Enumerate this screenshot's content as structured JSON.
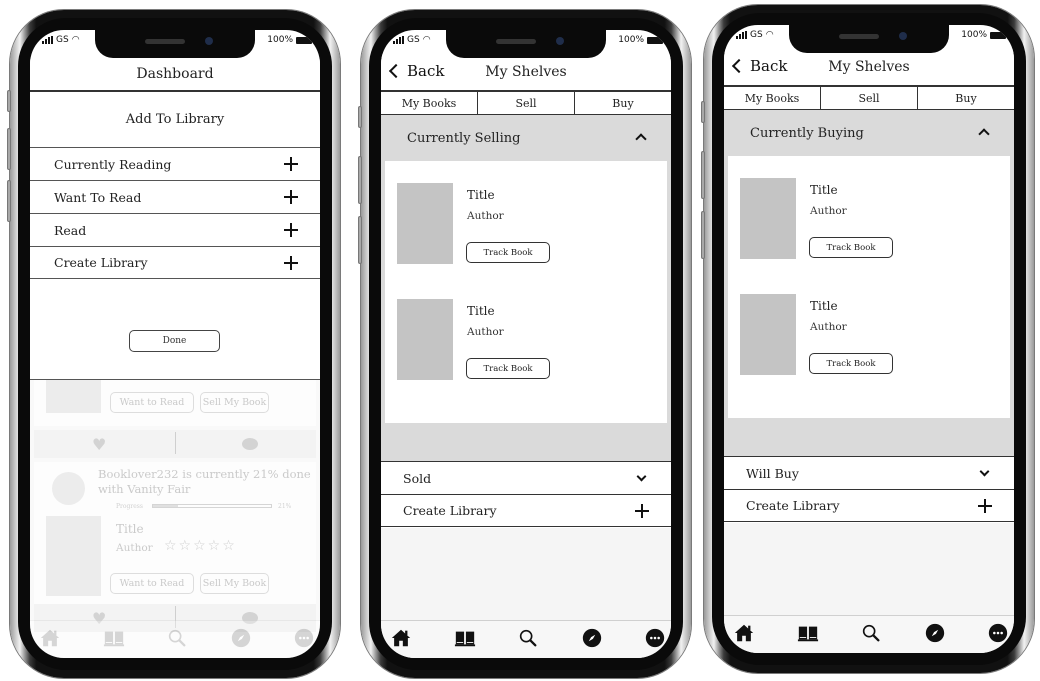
{
  "status_bar": {
    "carrier": "GS",
    "battery": "100%"
  },
  "phone1": {
    "header_title": "Dashboard",
    "modal": {
      "title": "Add To Library",
      "items": [
        {
          "label": "Currently Reading",
          "icon": "plus-icon"
        },
        {
          "label": "Want To Read",
          "icon": "plus-icon"
        },
        {
          "label": "Read",
          "icon": "plus-icon"
        },
        {
          "label": "Create Library",
          "icon": "plus-icon"
        }
      ],
      "done_label": "Done"
    },
    "background_feed": {
      "post1": {
        "want_to_read_label": "Want to Read",
        "sell_label": "Sell My Book"
      },
      "post2": {
        "activity_text_line1": "Booklover232 is currently 21% done",
        "activity_text_line2": "with Vanity Fair",
        "progress_label": "Progress",
        "progress_value": "21%",
        "progress_fraction": 0.21,
        "title": "Title",
        "author": "Author",
        "stars": "☆☆☆☆☆",
        "rating": 0,
        "want_to_read_label": "Want to Read",
        "sell_label": "Sell My Book"
      }
    }
  },
  "phone2": {
    "back_label": "Back",
    "header_title": "My Shelves",
    "tabs": [
      "My Books",
      "Sell",
      "Buy"
    ],
    "section_title": "Currently Selling",
    "books": [
      {
        "title": "Title",
        "author": "Author",
        "button": "Track Book"
      },
      {
        "title": "Title",
        "author": "Author",
        "button": "Track Book"
      }
    ],
    "rows": [
      {
        "label": "Sold",
        "icon": "chevron-down-icon"
      },
      {
        "label": "Create Library",
        "icon": "plus-icon"
      }
    ]
  },
  "phone3": {
    "back_label": "Back",
    "header_title": "My Shelves",
    "tabs": [
      "My Books",
      "Sell",
      "Buy"
    ],
    "section_title": "Currently Buying",
    "books": [
      {
        "title": "Title",
        "author": "Author",
        "button": "Track Book"
      },
      {
        "title": "Title",
        "author": "Author",
        "button": "Track Book"
      }
    ],
    "rows": [
      {
        "label": "Will Buy",
        "icon": "chevron-down-icon"
      },
      {
        "label": "Create Library",
        "icon": "plus-icon"
      }
    ]
  },
  "tab_bar": [
    "home-icon",
    "book-icon",
    "search-icon",
    "compass-icon",
    "more-icon"
  ]
}
